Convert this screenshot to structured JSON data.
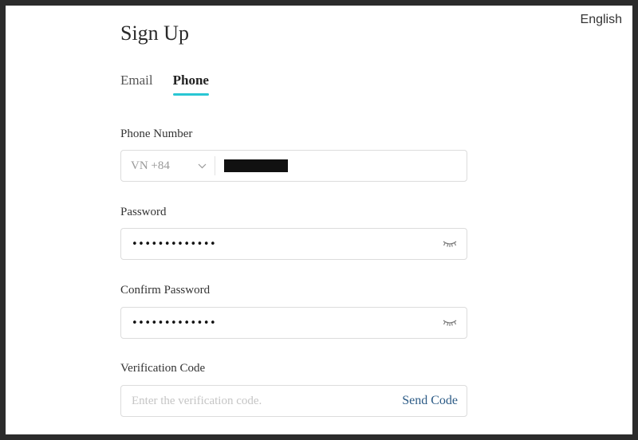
{
  "header": {
    "language_label": "English"
  },
  "page": {
    "title": "Sign Up"
  },
  "tabs": [
    {
      "label": "Email",
      "active": false
    },
    {
      "label": "Phone",
      "active": true
    }
  ],
  "colors": {
    "tab_underline": "#29c6d3",
    "link": "#2c5b86"
  },
  "phone": {
    "label": "Phone Number",
    "country_code": "VN +84",
    "value_redacted": true
  },
  "password": {
    "label": "Password",
    "value": "•••••••••••••"
  },
  "confirm_password": {
    "label": "Confirm Password",
    "value": "•••••••••••••"
  },
  "verification": {
    "label": "Verification Code",
    "placeholder": "Enter the verification code.",
    "send_label": "Send Code"
  },
  "icons": {
    "country_dropdown": "chevron-down-icon",
    "toggle_visibility": "eye-closed-icon"
  }
}
